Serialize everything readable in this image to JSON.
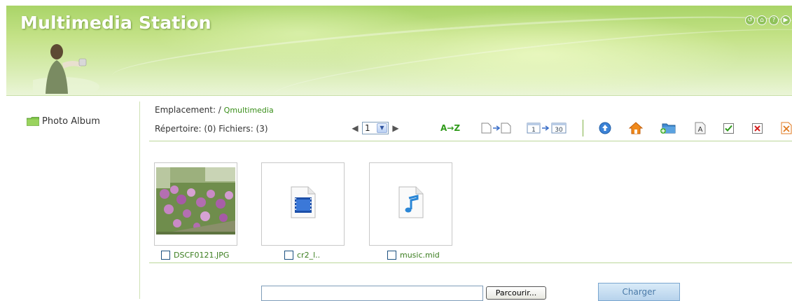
{
  "header": {
    "app_title": "Multimedia Station",
    "top_icons": [
      "logout-icon",
      "home-icon",
      "help-icon",
      "next-icon"
    ]
  },
  "sidebar": {
    "items": [
      {
        "label": "Photo Album",
        "icon": "folder-icon"
      }
    ]
  },
  "location": {
    "label": "Emplacement: /",
    "path_link": "Qmultimedia"
  },
  "summary": {
    "text": "Répertoire: (0) Fichiers: (3)"
  },
  "pager": {
    "current_page": "1"
  },
  "toolbar": {
    "sort_label": "A→Z",
    "date_range_from": "1",
    "date_range_to": "30",
    "icons": [
      "sort-az-icon",
      "file-move-icon",
      "date-range-icon",
      "up-folder-icon",
      "home-icon",
      "new-folder-icon",
      "rename-icon",
      "select-all-icon",
      "delete-icon",
      "deselect-icon"
    ]
  },
  "files": [
    {
      "name": "DSCF0121.JPG",
      "type": "image",
      "icon": "photo-thumbnail"
    },
    {
      "name": "cr2_l..",
      "type": "video",
      "icon": "video-file-icon"
    },
    {
      "name": "music.mid",
      "type": "audio",
      "icon": "music-file-icon"
    }
  ],
  "upload": {
    "file_value": "",
    "browse_label": "Parcourir...",
    "submit_label": "Charger"
  },
  "colors": {
    "banner_green": "#a9d468",
    "link_green": "#3a8f1a",
    "rule_green": "#bcd79a",
    "delete_red": "#d42020"
  }
}
